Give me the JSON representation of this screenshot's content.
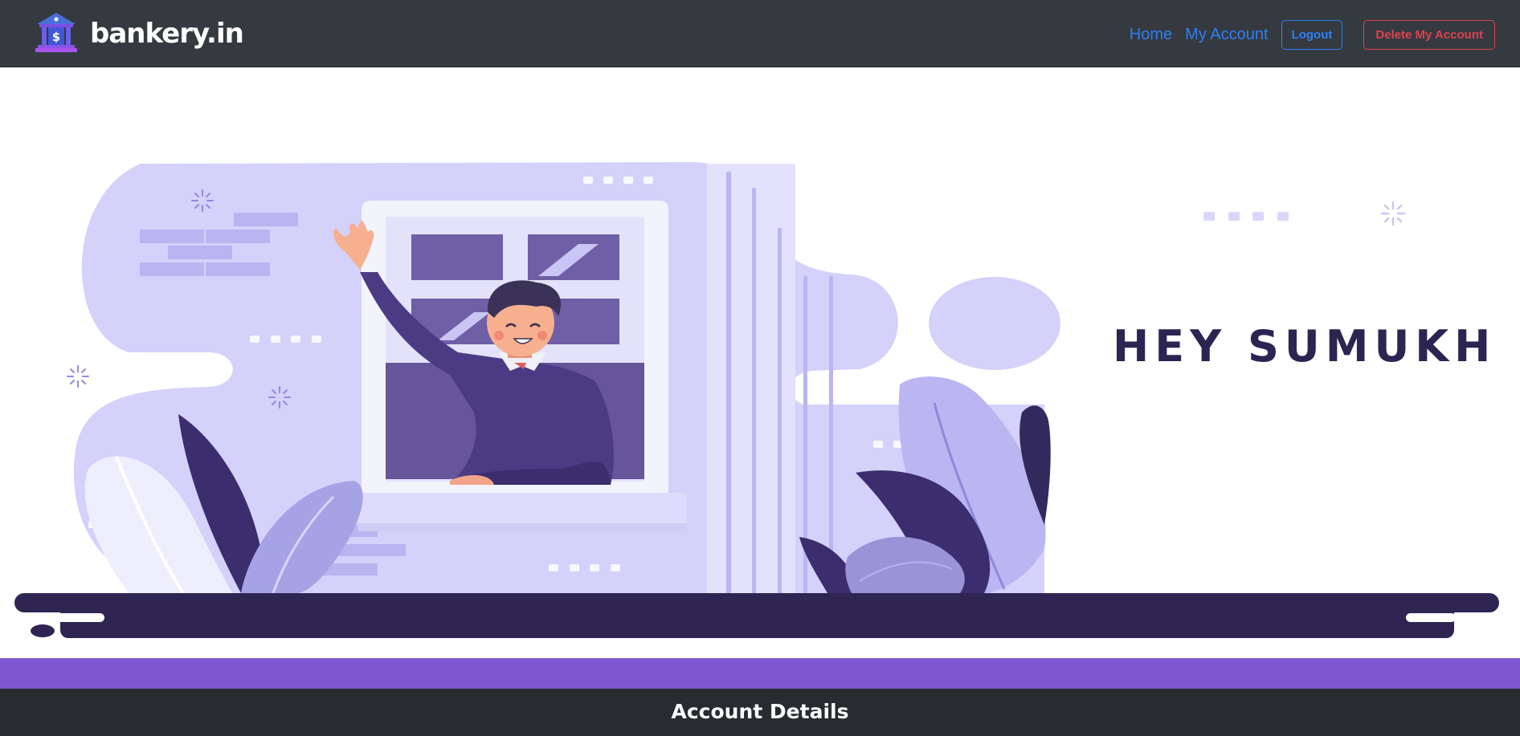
{
  "navbar": {
    "brand": "bankery.in",
    "brand_icon": "bank-building-icon",
    "links": [
      {
        "label": "Home"
      },
      {
        "label": "My Account"
      }
    ],
    "logout_label": "Logout",
    "delete_label": "Delete My Account"
  },
  "hero": {
    "greeting": "HEY SUMUKH",
    "illustration": "man-waving-from-window"
  },
  "account": {
    "title": "Account Details"
  },
  "colors": {
    "navbar_bg": "#343a40",
    "accent_blue": "#2f7ff5",
    "danger_red": "#e0414f",
    "purple": "#7e57d0",
    "dark_purple": "#2d2452",
    "lavender": "#d4d2fb"
  }
}
